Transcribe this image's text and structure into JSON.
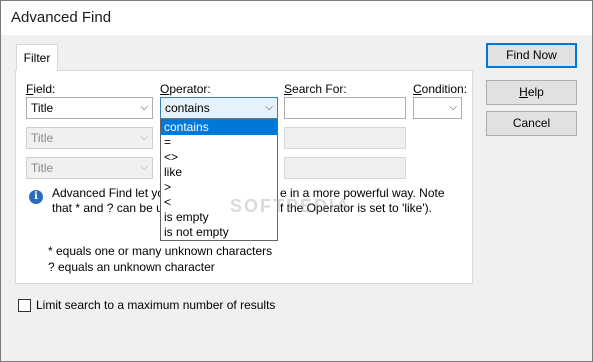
{
  "window": {
    "title": "Advanced Find"
  },
  "tabs": [
    {
      "label": "Filter"
    }
  ],
  "columns": {
    "field": {
      "label": "Field:"
    },
    "operator": {
      "label": "Operator:"
    },
    "search_for": {
      "label": "Search For:"
    },
    "condition": {
      "label": "Condition:"
    }
  },
  "rows": [
    {
      "field": "Title",
      "operator": "contains",
      "search": "",
      "enabled": true
    },
    {
      "field": "Title",
      "enabled": false
    },
    {
      "field": "Title",
      "enabled": false
    }
  ],
  "operator_dropdown": {
    "options": [
      "contains",
      "=",
      "<>",
      "like",
      ">",
      "<",
      "is empty",
      "is not empty"
    ],
    "selected": "contains"
  },
  "info": {
    "line1a": "Advanced Find let yo",
    "line1b": "e in a more powerful way. Note",
    "line2a": "that * and ? can be us",
    "line2b": "f the Operator is set to 'like')."
  },
  "help": {
    "line1": "* equals one or many unknown characters",
    "line2": "? equals an unknown character"
  },
  "limit_checkbox": {
    "label": "Limit search to a maximum number of results",
    "checked": false
  },
  "buttons": {
    "find_now": "Find Now",
    "help": "Help",
    "cancel": "Cancel"
  },
  "watermark": "SOFTPEDIA",
  "icons": {
    "info": "info-icon",
    "dropdown_arrow": "chevron-down-icon"
  }
}
